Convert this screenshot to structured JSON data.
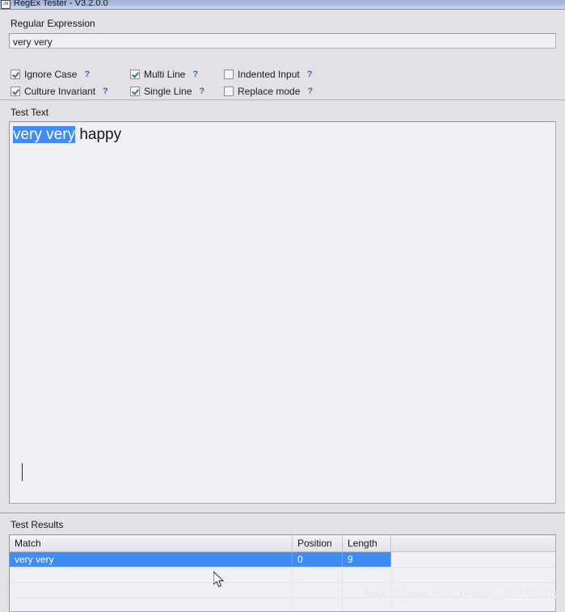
{
  "window": {
    "title": "RegEx Tester - V3.2.0.0",
    "icon": "rx-icon",
    "icon_text": ".rx"
  },
  "regex_section": {
    "label": "Regular Expression",
    "value": "very very",
    "placeholder": ""
  },
  "options": {
    "help_marker": "?",
    "items": [
      {
        "label": "Ignore Case",
        "checked": true,
        "help": "?"
      },
      {
        "label": "Multi Line",
        "checked": true,
        "help": "?"
      },
      {
        "label": "Indented Input",
        "checked": false,
        "help": "?"
      },
      {
        "label": "Culture Invariant",
        "checked": true,
        "help": "?"
      },
      {
        "label": "Single Line",
        "checked": true,
        "help": "?"
      },
      {
        "label": "Replace mode",
        "checked": false,
        "help": "?"
      }
    ]
  },
  "test_text": {
    "label": "Test Text",
    "highlighted": "very very",
    "remainder": " happy"
  },
  "test_results": {
    "label": "Test Results",
    "columns": [
      "Match",
      "Position",
      "Length",
      ""
    ],
    "rows": [
      {
        "match": "very very",
        "position": "0",
        "length": "9",
        "selected": true
      },
      {
        "match": "",
        "position": "",
        "length": "",
        "selected": false
      },
      {
        "match": "",
        "position": "",
        "length": "",
        "selected": false
      },
      {
        "match": "",
        "position": "",
        "length": "",
        "selected": false
      }
    ]
  },
  "watermark": {
    "text": "https://blog.csdn.net/qq_42227818"
  },
  "colors": {
    "selection_blue": "#3f8cf3",
    "titlebar_blue": "#a9bcdd",
    "panel_gray": "#e3e1e6",
    "field_bg": "#f1eff4",
    "help_link": "#4a5fb0"
  }
}
